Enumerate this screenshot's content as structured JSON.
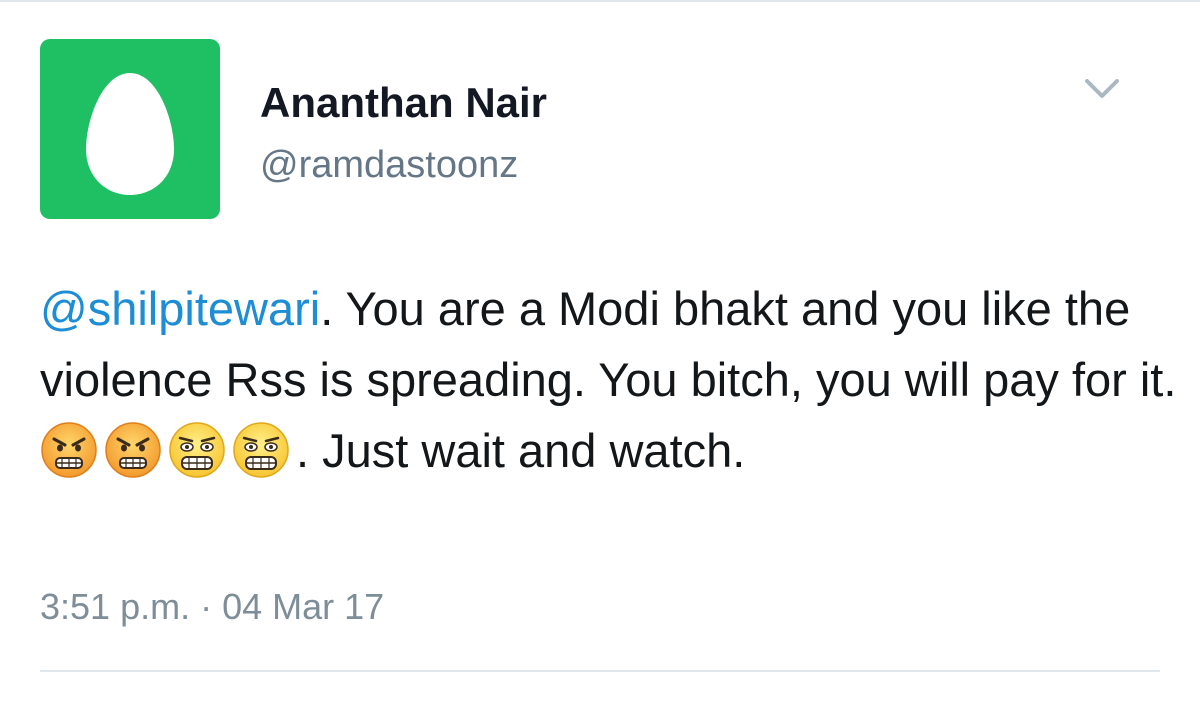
{
  "tweet": {
    "author": {
      "display_name": "Ananthan Nair",
      "handle": "@ramdastoonz",
      "avatar": "default-egg-avatar",
      "avatar_color": "#1fbf63"
    },
    "menu_icon": "chevron-down-icon",
    "mention": "@shilpitewari",
    "text_part1": ". You are a Modi bhakt and you like the violence Rss is spreading. You bitch, you will pay for it. ",
    "emojis": [
      "angry-face-icon",
      "angry-face-icon",
      "grimacing-face-icon",
      "grimacing-face-icon"
    ],
    "text_part2": ". Just wait and watch.",
    "timestamp": "3:51 p.m. · 04 Mar 17",
    "mention_color": "#1d8dd6"
  }
}
